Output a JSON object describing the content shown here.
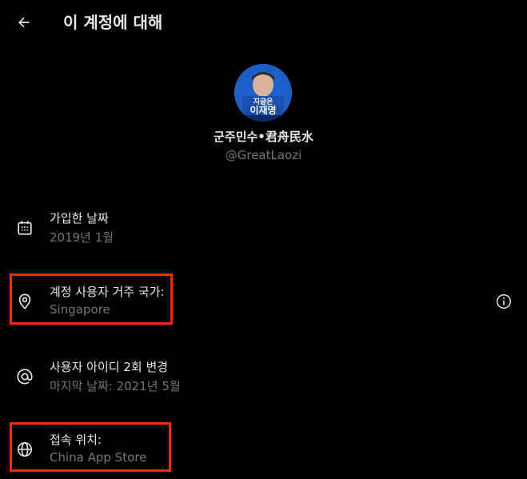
{
  "header": {
    "title": "이 계정에 대해",
    "back_icon": "arrow-left-icon"
  },
  "profile": {
    "avatar_text_line1": "지금은",
    "avatar_text_line2": "이재명",
    "display_name": "군주민수•君舟民水",
    "handle": "@GreatLaozi"
  },
  "details": [
    {
      "icon": "calendar-icon",
      "label": "가입한 날짜",
      "value": "2019년 1월"
    },
    {
      "icon": "location-pin-icon",
      "label": "계정 사용자 거주 국가:",
      "value": "Singapore"
    },
    {
      "icon": "at-sign-icon",
      "label": "사용자 아이디 2회 변경",
      "value": "마지막 날짜: 2021년 5월"
    },
    {
      "icon": "globe-icon",
      "label": "접속 위치:",
      "value": "China App Store"
    }
  ],
  "info_icon": "info-circle-icon",
  "colors": {
    "background": "#000000",
    "primary_text": "#e7e9ea",
    "secondary_text": "#71767b",
    "highlight_border": "#ff2a0a",
    "avatar_bg": "#1d5fc7"
  }
}
